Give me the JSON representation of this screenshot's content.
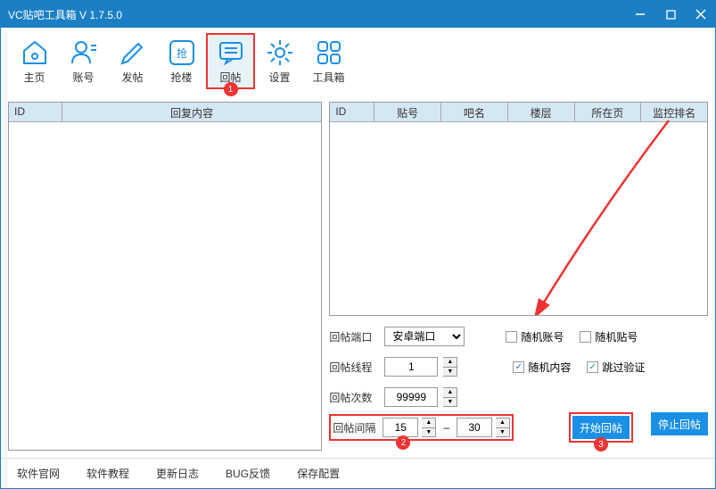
{
  "window": {
    "title": "VC贴吧工具箱 V 1.7.5.0"
  },
  "toolbar": {
    "items": [
      {
        "label": "主页"
      },
      {
        "label": "账号"
      },
      {
        "label": "发帖"
      },
      {
        "label": "抢楼",
        "text": "抢"
      },
      {
        "label": "回帖"
      },
      {
        "label": "设置"
      },
      {
        "label": "工具箱"
      }
    ]
  },
  "leftTable": {
    "headers": [
      "ID",
      "回复内容"
    ]
  },
  "rightTable": {
    "headers": [
      "ID",
      "贴号",
      "吧名",
      "楼层",
      "所在页",
      "监控排名"
    ]
  },
  "controls": {
    "portLabel": "回帖端口",
    "portValue": "安卓端口",
    "threadLabel": "回帖线程",
    "threadValue": "1",
    "countLabel": "回帖次数",
    "countValue": "99999",
    "intervalLabel": "回帖间隔",
    "intervalMin": "15",
    "intervalMax": "30",
    "intervalSep": "–"
  },
  "checks": {
    "randomAccount": "随机账号",
    "randomPost": "随机贴号",
    "randomContent": "随机内容",
    "skipVerify": "跳过验证"
  },
  "buttons": {
    "start": "开始回帖",
    "stop": "停止回帖"
  },
  "badges": {
    "b1": "1",
    "b2": "2",
    "b3": "3"
  },
  "footer": {
    "links": [
      "软件官网",
      "软件教程",
      "更新日志",
      "BUG反馈",
      "保存配置"
    ]
  }
}
